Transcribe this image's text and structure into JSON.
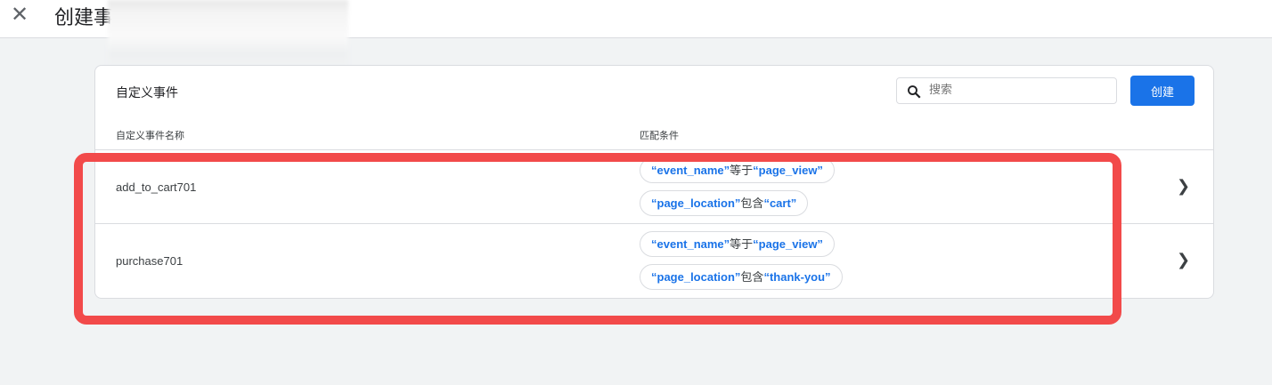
{
  "header": {
    "title": "创建事"
  },
  "card": {
    "title": "自定义事件",
    "search_placeholder": "搜索",
    "create_label": "创建",
    "columns": [
      "自定义事件名称",
      "匹配条件"
    ],
    "rows": [
      {
        "name": "add_to_cart701",
        "conditions": [
          {
            "param": "“event_name”",
            "op": "等于",
            "value": "“page_view”"
          },
          {
            "param": "“page_location”",
            "op": "包含",
            "value": "“cart”"
          }
        ]
      },
      {
        "name": "purchase701",
        "conditions": [
          {
            "param": "“event_name”",
            "op": "等于",
            "value": "“page_view”"
          },
          {
            "param": "“page_location”",
            "op": "包含",
            "value": "“thank-you”"
          }
        ]
      }
    ]
  },
  "colors": {
    "accent": "#1a73e8",
    "highlight": "#f24a4a"
  }
}
